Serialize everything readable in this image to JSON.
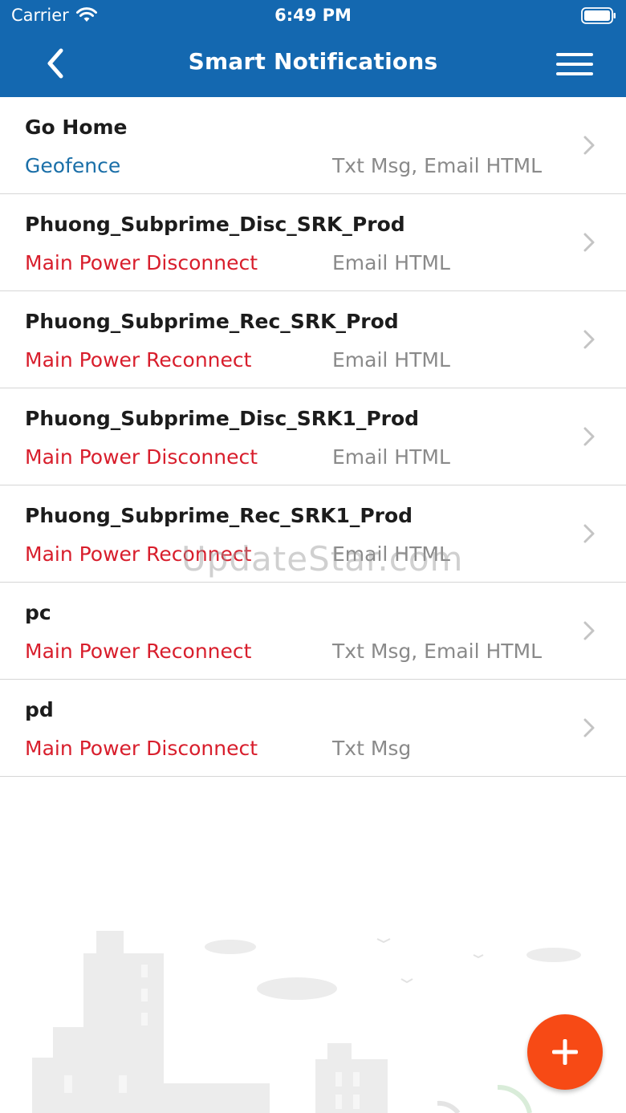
{
  "status_bar": {
    "carrier": "Carrier",
    "time": "6:49 PM"
  },
  "nav": {
    "title": "Smart Notifications"
  },
  "colors": {
    "header_bg": "#1468b0",
    "geofence": "#1a6fa8",
    "power_alert": "#d81e2c",
    "channel_text": "#8a8a8a",
    "fab": "#f74a15"
  },
  "notifications": [
    {
      "name": "Go Home",
      "type": "Geofence",
      "channels": "Txt Msg, Email HTML",
      "type_color": "#1a6fa8"
    },
    {
      "name": "Phuong_Subprime_Disc_SRK_Prod",
      "type": "Main Power Disconnect",
      "channels": "Email HTML",
      "type_color": "#d81e2c"
    },
    {
      "name": "Phuong_Subprime_Rec_SRK_Prod",
      "type": "Main Power Reconnect",
      "channels": "Email HTML",
      "type_color": "#d81e2c"
    },
    {
      "name": "Phuong_Subprime_Disc_SRK1_Prod",
      "type": "Main Power Disconnect",
      "channels": "Email HTML",
      "type_color": "#d81e2c"
    },
    {
      "name": "Phuong_Subprime_Rec_SRK1_Prod",
      "type": "Main Power Reconnect",
      "channels": "Email HTML",
      "type_color": "#d81e2c"
    },
    {
      "name": "pc",
      "type": "Main Power Reconnect",
      "channels": "Txt Msg, Email HTML",
      "type_color": "#d81e2c"
    },
    {
      "name": "pd",
      "type": "Main Power Disconnect",
      "channels": "Txt Msg",
      "type_color": "#d81e2c"
    }
  ],
  "watermark": "UpdateStar.com",
  "icons": {
    "back": "chevron-left-icon",
    "menu": "hamburger-menu-icon",
    "row_chevron": "chevron-right-icon",
    "fab": "plus-icon",
    "wifi": "wifi-icon",
    "battery": "battery-icon"
  }
}
